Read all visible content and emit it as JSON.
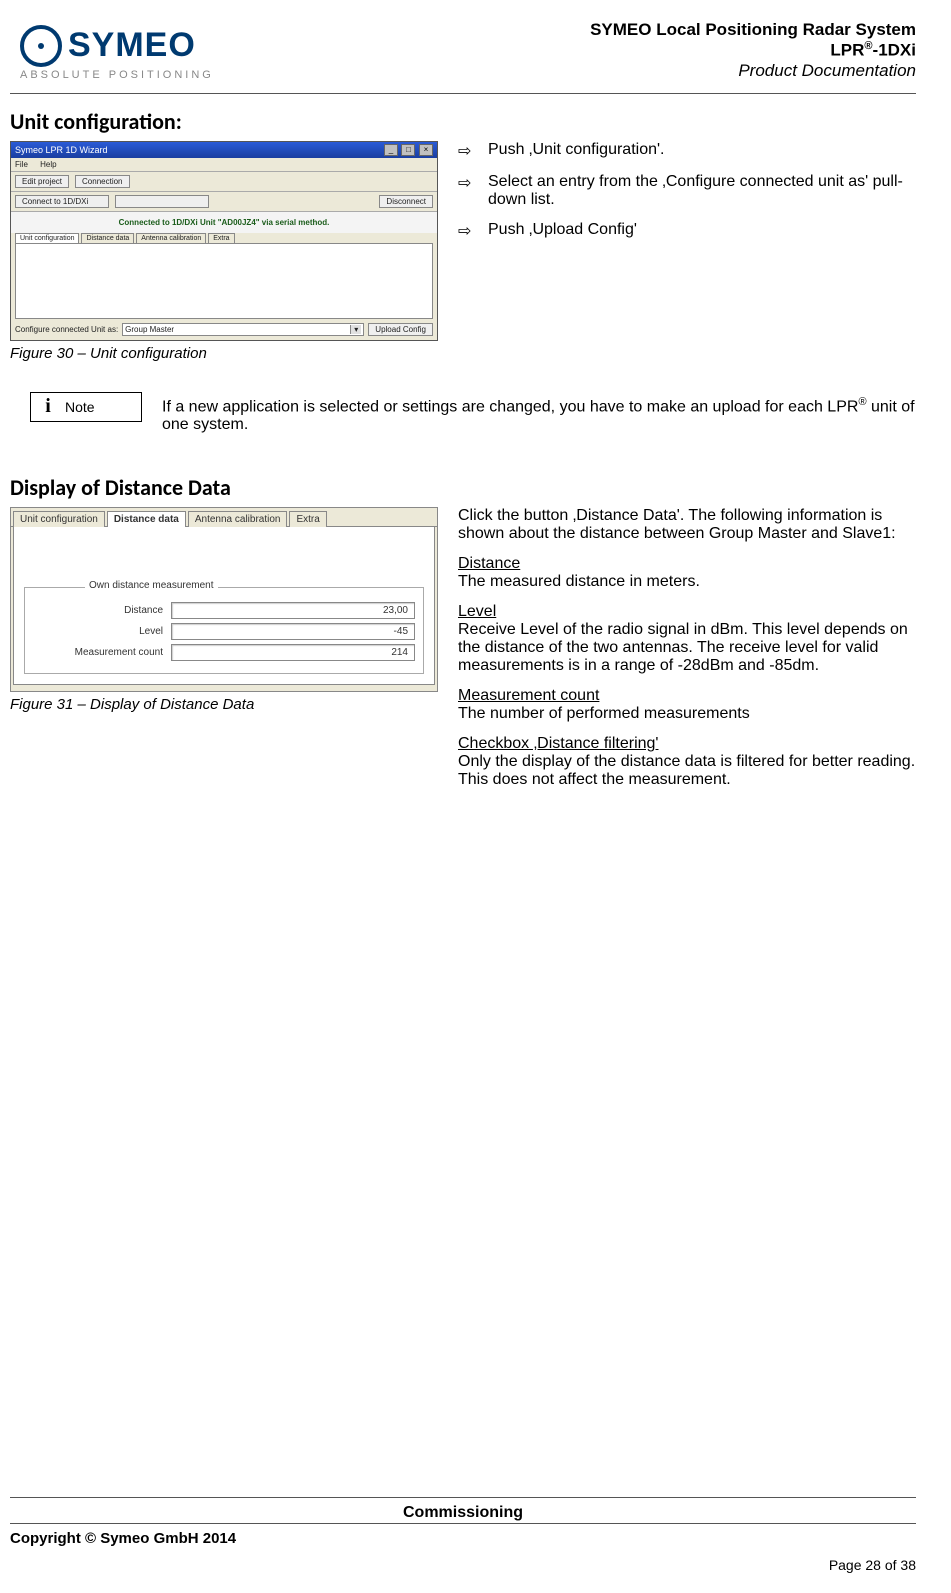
{
  "header": {
    "logo_word": "SYMEO",
    "logo_sub": "ABSOLUTE POSITIONING",
    "line1": "SYMEO Local Positioning Radar System",
    "line2_a": "LPR",
    "line2_sup": "®",
    "line2_b": "-1DXi",
    "line3": "Product Documentation"
  },
  "section1": {
    "heading": "Unit configuration:",
    "caption": "Figure 30 – Unit configuration",
    "bullets": [
      "Push ‚Unit configuration'.",
      "Select an entry from the ‚Configure connected unit as' pull-down list.",
      "Push ‚Upload Config'"
    ]
  },
  "shot1": {
    "title": "Symeo LPR 1D Wizard",
    "menu_file": "File",
    "menu_help": "Help",
    "btn_edit": "Edit project",
    "btn_conn": "Connection",
    "btn_disc": "Disconnect",
    "btn_connect_long": "Connect to 1D/DXi",
    "btn_extra1": "",
    "status": "Connected to 1D/DXi Unit \"AD00JZ4\" via serial method.",
    "tab_unit": "Unit configuration",
    "tab_dist": "Distance data",
    "tab_ant": "Antenna calibration",
    "tab_extra": "Extra",
    "select_label": "Configure connected Unit as:",
    "select_value": "Group Master",
    "btn_upload": "Upload Config"
  },
  "note": {
    "label": "Note",
    "text_a": "If a new application is selected or settings are changed, you have to make an upload for each LPR",
    "text_sup": "®",
    "text_b": " unit of one system."
  },
  "section2": {
    "heading": "Display of Distance Data",
    "caption": "Figure 31 – Display of Distance Data"
  },
  "shot2": {
    "tab_unit": "Unit configuration",
    "tab_dist": "Distance data",
    "tab_ant": "Antenna calibration",
    "tab_extra": "Extra",
    "group_legend": "Own distance measurement",
    "lbl_distance": "Distance",
    "val_distance": "23,00",
    "lbl_level": "Level",
    "val_level": "-45",
    "lbl_count": "Measurement count",
    "val_count": "214"
  },
  "defs": {
    "intro": "Click the button ‚Distance Data'. The following information is shown about the distance between Group Master and Slave1:",
    "t1": "Distance",
    "d1": "The measured distance in meters.",
    "t2": "Level",
    "d2": "Receive Level of the radio signal in dBm. This level depends on the distance of the two antennas. The receive level for valid measurements is in a range of -28dBm and -85dm.",
    "t3": "Measurement count",
    "d3": "The number of performed measurements",
    "t4": "Checkbox ‚Distance filtering'",
    "d4": "Only the display of the distance data is filtered for better reading. This does not affect the measurement."
  },
  "footer": {
    "center": "Commissioning",
    "copyright": "Copyright © Symeo GmbH 2014",
    "page": "Page 28 of 38"
  }
}
